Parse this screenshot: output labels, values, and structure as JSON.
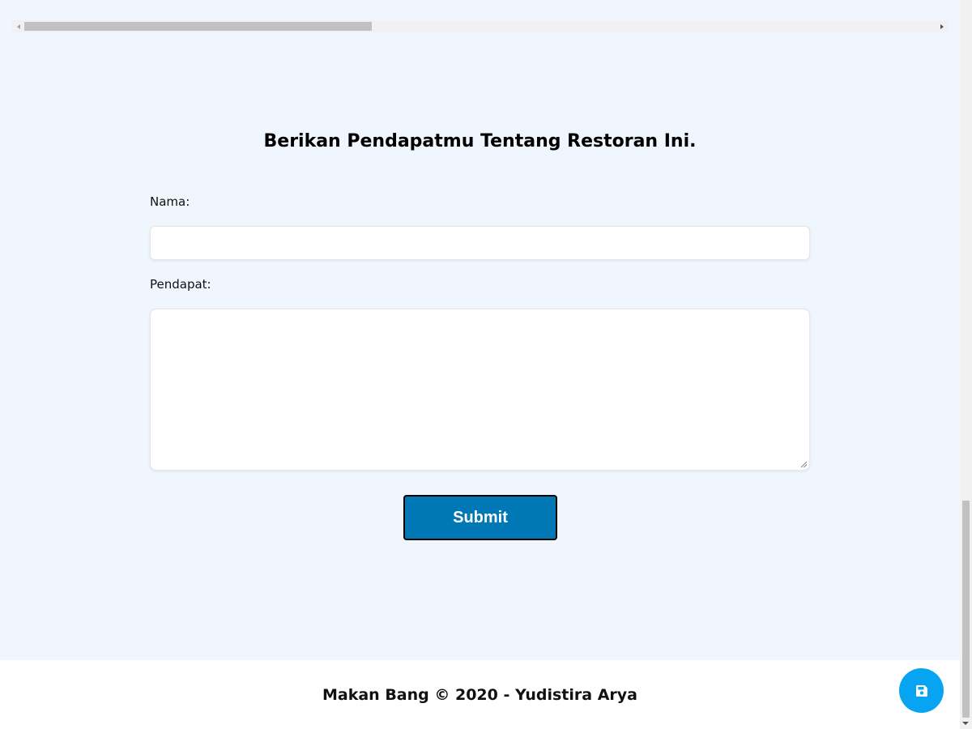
{
  "heading": "Berikan Pendapatmu Tentang Restoran Ini.",
  "form": {
    "name_label": "Nama:",
    "name_value": "",
    "opinion_label": "Pendapat:",
    "opinion_value": "",
    "submit_label": "Submit"
  },
  "footer": {
    "text": "Makan Bang © 2020 - Yudistira Arya"
  },
  "fab": {
    "icon": "save-icon"
  },
  "colors": {
    "page_bg": "#eff6fd",
    "submit_bg": "#0178b6",
    "fab_bg": "#06a4f1"
  }
}
